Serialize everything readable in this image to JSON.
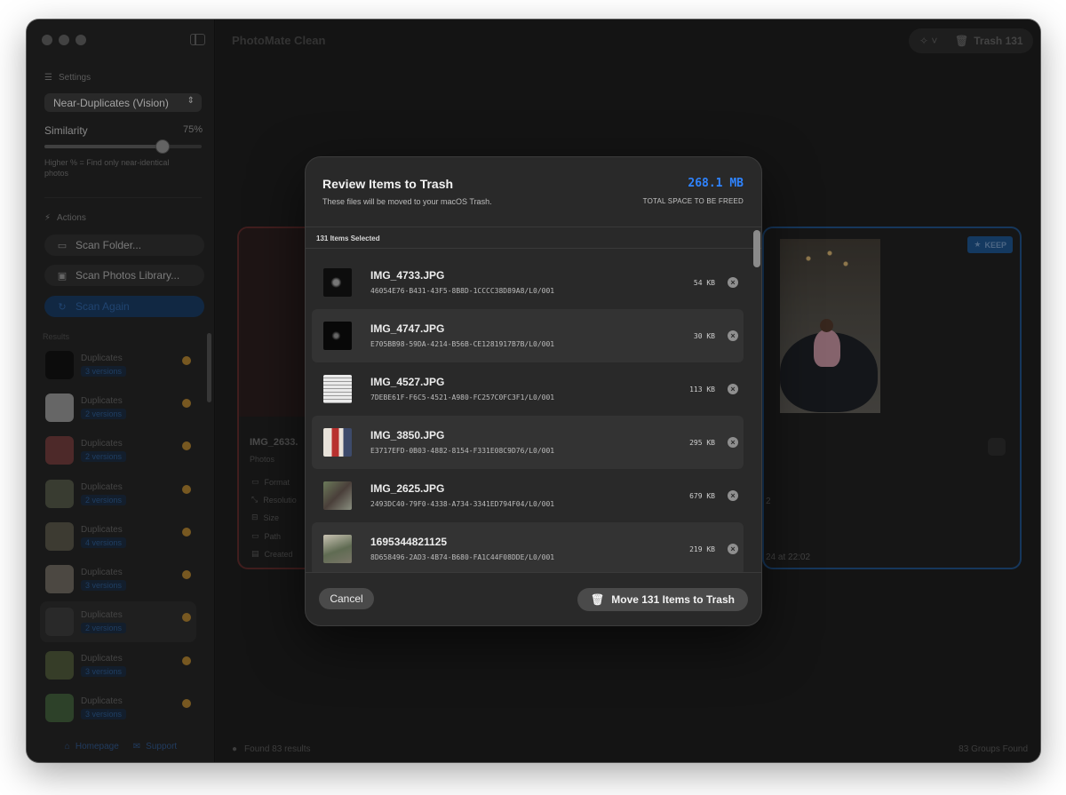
{
  "app": {
    "title": "PhotoMate Clean",
    "trash_label": "Trash 131"
  },
  "sidebar": {
    "settings_label": "Settings",
    "mode_select": "Near-Duplicates (Vision)",
    "similarity_label": "Similarity",
    "similarity_value": "75%",
    "similarity_fraction": 0.75,
    "hint": "Higher % = Find only near-identical photos",
    "actions_label": "Actions",
    "actions": [
      {
        "label": "Scan Folder...",
        "icon": "folder-icon"
      },
      {
        "label": "Scan Photos Library...",
        "icon": "photos-icon"
      },
      {
        "label": "Scan Again",
        "icon": "refresh-icon"
      }
    ],
    "results_label": "Results",
    "results": [
      {
        "title": "Duplicates",
        "versions": "3 versions"
      },
      {
        "title": "Duplicates",
        "versions": "2 versions"
      },
      {
        "title": "Duplicates",
        "versions": "2 versions"
      },
      {
        "title": "Duplicates",
        "versions": "2 versions"
      },
      {
        "title": "Duplicates",
        "versions": "4 versions"
      },
      {
        "title": "Duplicates",
        "versions": "3 versions"
      },
      {
        "title": "Duplicates",
        "versions": "2 versions"
      },
      {
        "title": "Duplicates",
        "versions": "3 versions"
      },
      {
        "title": "Duplicates",
        "versions": "3 versions"
      }
    ],
    "footer": {
      "homepage": "Homepage",
      "support": "Support"
    }
  },
  "compare": {
    "left_name": "IMG_2633.",
    "left_source": "Photos",
    "meta": [
      "Format",
      "Resolutio",
      "Size",
      "Path",
      "Created"
    ],
    "keep_label": "KEEP",
    "right_fragment_1": "2",
    "right_fragment_2": "24 at 22:02"
  },
  "status": {
    "found": "Found 83 results",
    "groups": "83 Groups Found"
  },
  "modal": {
    "title": "Review Items to Trash",
    "subtitle": "These files will be moved to your macOS Trash.",
    "total_size": "268.1 MB",
    "total_label": "TOTAL SPACE TO BE FREED",
    "selected_count": "131 Items Selected",
    "items": [
      {
        "name": "IMG_4733.JPG",
        "id": "46054E76-B431-43F5-8B8D-1CCCC38D89A8/L0/001",
        "size": "54 KB"
      },
      {
        "name": "IMG_4747.JPG",
        "id": "E705BB98-59DA-4214-B56B-CE1281917B7B/L0/001",
        "size": "30 KB"
      },
      {
        "name": "IMG_4527.JPG",
        "id": "7DEBE61F-F6C5-4521-A980-FC257C0FC3F1/L0/001",
        "size": "113 KB"
      },
      {
        "name": "IMG_3850.JPG",
        "id": "E3717EFD-0B03-4882-8154-F331E08C9D76/L0/001",
        "size": "295 KB"
      },
      {
        "name": "IMG_2625.JPG",
        "id": "2493DC40-79F0-4338-A734-3341ED794F04/L0/001",
        "size": "679 KB"
      },
      {
        "name": "1695344821125",
        "id": "8D658496-2AD3-4B74-B680-FA1C44F08DDE/L0/001",
        "size": "219 KB"
      }
    ],
    "cancel_label": "Cancel",
    "move_label": "Move 131 Items to Trash"
  }
}
